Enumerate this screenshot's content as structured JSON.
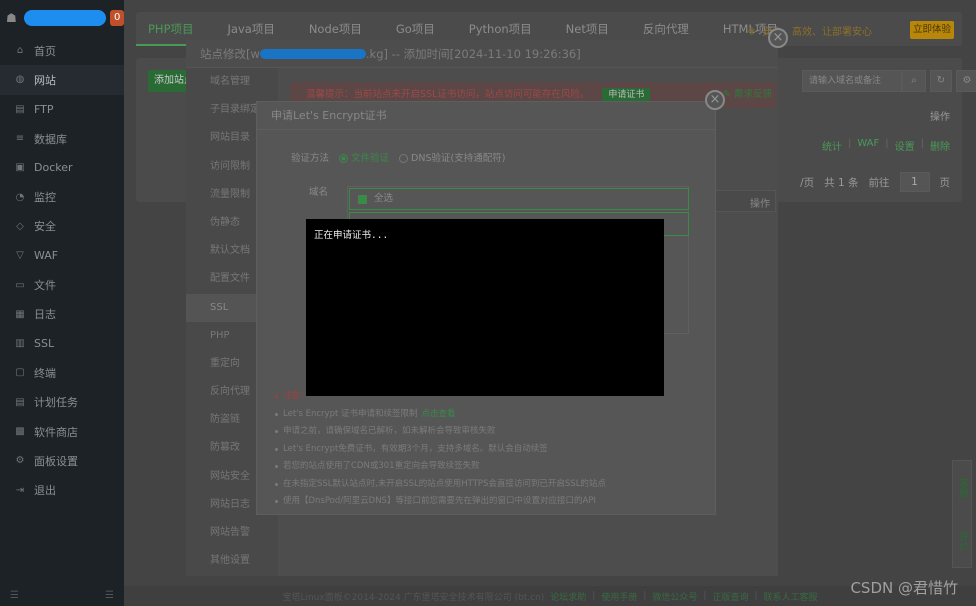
{
  "sidebar": {
    "badge": "0",
    "items": [
      {
        "icon": "⌂",
        "label": "首页"
      },
      {
        "icon": "◍",
        "label": "网站"
      },
      {
        "icon": "▤",
        "label": "FTP"
      },
      {
        "icon": "≡",
        "label": "数据库"
      },
      {
        "icon": "▣",
        "label": "Docker"
      },
      {
        "icon": "◔",
        "label": "监控"
      },
      {
        "icon": "◇",
        "label": "安全"
      },
      {
        "icon": "▽",
        "label": "WAF"
      },
      {
        "icon": "▭",
        "label": "文件"
      },
      {
        "icon": "▦",
        "label": "日志"
      },
      {
        "icon": "▥",
        "label": "SSL"
      },
      {
        "icon": "▢",
        "label": "终端"
      },
      {
        "icon": "▤",
        "label": "计划任务"
      },
      {
        "icon": "▩",
        "label": "软件商店"
      },
      {
        "icon": "⚙",
        "label": "面板设置"
      },
      {
        "icon": "⇥",
        "label": "退出"
      }
    ]
  },
  "tabs": [
    "PHP项目",
    "Java项目",
    "Node项目",
    "Go项目",
    "Python项目",
    "Net项目",
    "反向代理",
    "HTML项目"
  ],
  "promo": {
    "text": "安全、高效、让部署安心",
    "button": "立即体验"
  },
  "site_list": {
    "add_button": "添加站点",
    "search_placeholder": "请输入域名或备注",
    "op_header": "操作",
    "op_links": [
      "统计",
      "WAF",
      "设置",
      "删除"
    ],
    "page_total": "共 1 条",
    "goto_label": "前往",
    "page_num": "1",
    "page_unit": "页",
    "per_page": "/页"
  },
  "site_modal": {
    "title": "站点修改[w",
    "title_suffix": ".kg] -- 添加时间[2024-11-10 19:26:36]",
    "menu": [
      "域名管理",
      "子目录绑定",
      "网站目录",
      "访问限制",
      "流量限制",
      "伪静态",
      "默认文档",
      "配置文件",
      "SSL",
      "PHP",
      "重定向",
      "反向代理",
      "防盗链",
      "防篡改",
      "网站安全",
      "网站日志",
      "网站告警",
      "其他设置"
    ],
    "active_menu": "SSL",
    "warning": "温馨提示：当前站点未开启SSL证书访问，站点访问可能存在风险。",
    "warning_button": "申请证书",
    "feedback": "需求反馈",
    "op_header": "操作"
  },
  "le_modal": {
    "title": "申请Let's Encrypt证书",
    "verify_label": "验证方法",
    "file_verify": "文件验证",
    "dns_verify": "DNS验证(支持通配符)",
    "domain_label": "域名",
    "select_all": "全选",
    "notes": [
      "注意：",
      "Let's Encrypt 证书申请和续签限制",
      "申请之前，请确保域名已解析，如未解析会导致审核失败",
      "Let's Encrypt免费证书，有效期3个月，支持多域名。默认会自动续签",
      "若您的站点使用了CDN或301重定向会导致续签失败",
      "在未指定SSL默认站点时,未开启SSL的站点使用HTTPS会直接访问到已开启SSL的站点",
      "使用【DnsPod/阿里云DNS】等接口前您需要先在弹出的窗口中设置对应接口的API"
    ],
    "limit_link": "点击查看"
  },
  "terminal": {
    "text": "正在申请证书..."
  },
  "footer": {
    "copyright": "宝塔Linux面板©2014-2024 广东堡塔安全技术有限公司 (bt.cn)",
    "links": [
      "论坛求助",
      "使用手册",
      "微信公众号",
      "正版查询",
      "联系人工客服"
    ]
  },
  "side_float": {
    "service": "客服",
    "review": "评价"
  },
  "watermark": "CSDN @君惜竹"
}
